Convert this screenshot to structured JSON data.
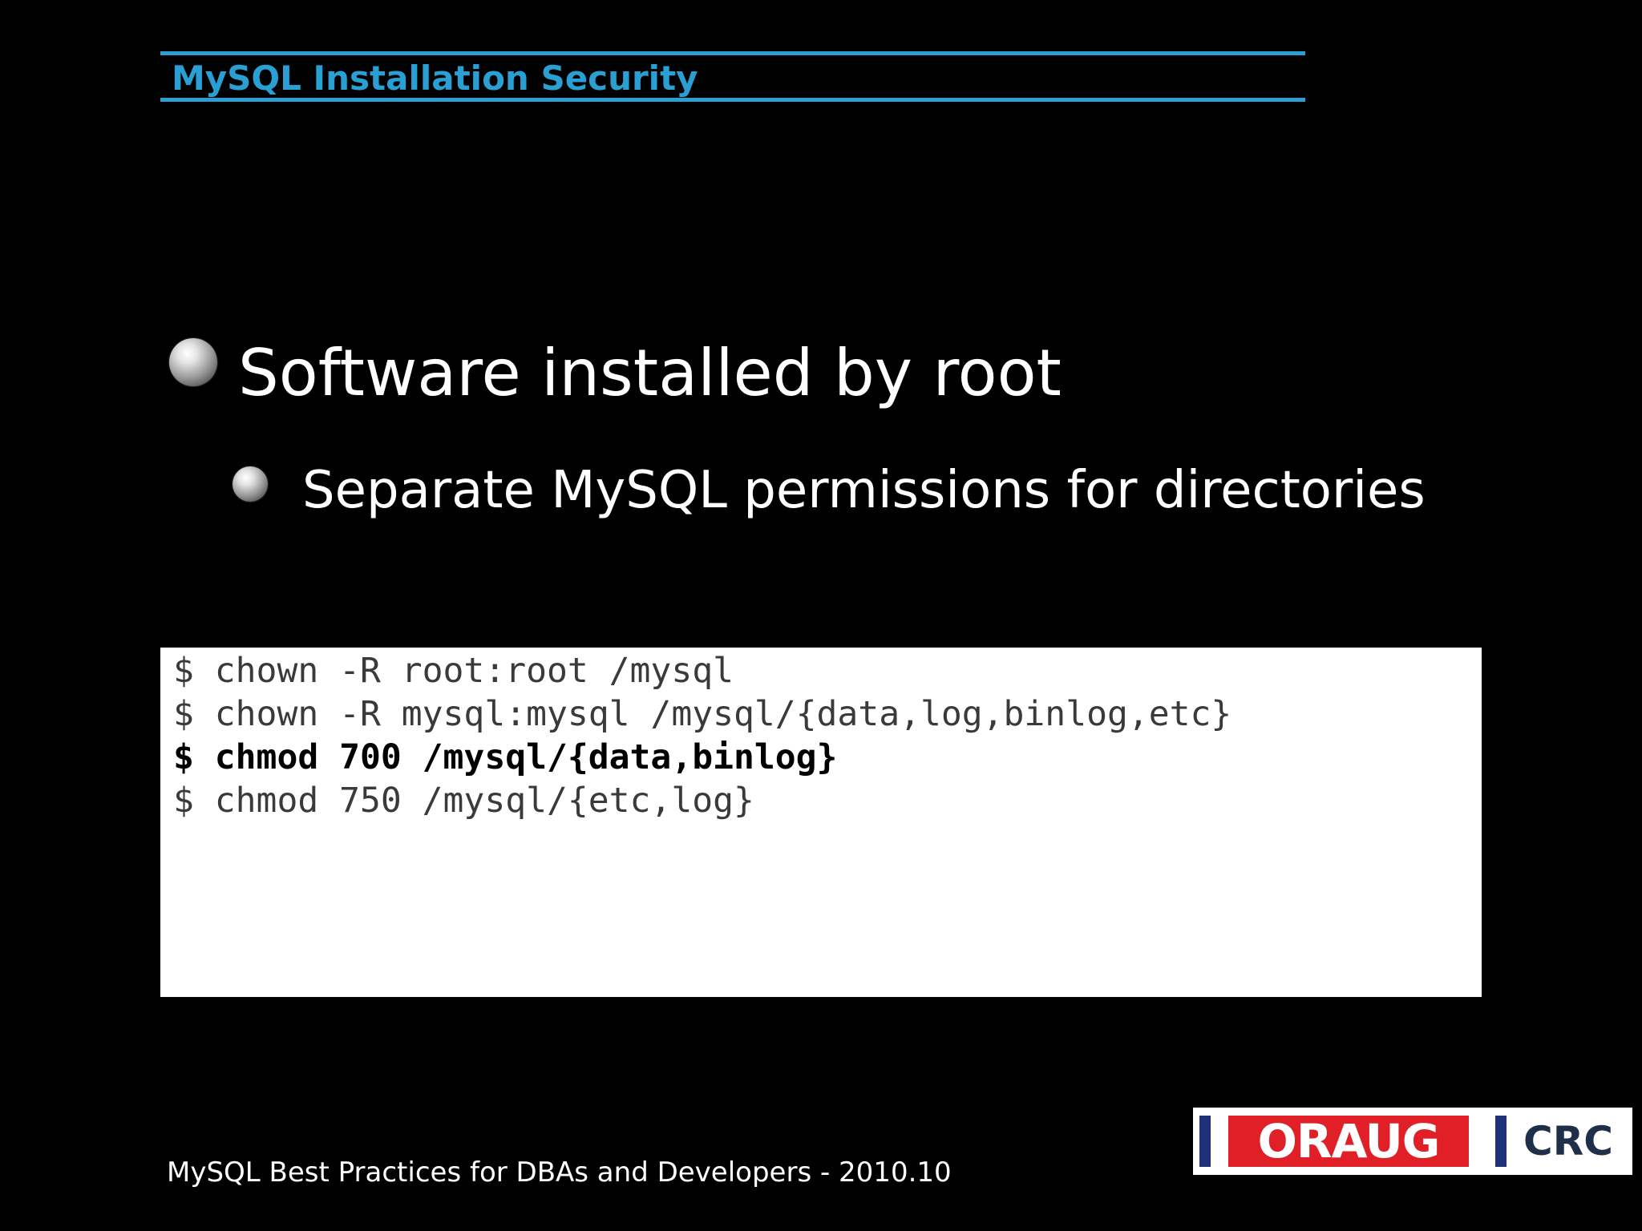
{
  "slide": {
    "title": "MySQL Installation Security",
    "bullets": [
      {
        "text": "Software installed by root"
      },
      {
        "text": "Separate MySQL permissions for directories"
      }
    ],
    "code": [
      {
        "text": "$ chown -R root:root /mysql",
        "bold": false
      },
      {
        "text": "$ chown -R mysql:mysql /mysql/{data,log,binlog,etc}",
        "bold": false
      },
      {
        "text": "$ chmod 700 /mysql/{data,binlog}",
        "bold": true
      },
      {
        "text": "$ chmod 750 /mysql/{etc,log}",
        "bold": false
      }
    ],
    "footer": "MySQL Best Practices for DBAs and Developers - 2010.10",
    "logo": {
      "left_text": "ORAUG",
      "right_text": "CRC",
      "colors": {
        "red": "#e02026",
        "navy": "#1f2f7a"
      }
    },
    "colors": {
      "background": "#000000",
      "accent": "#2a9fd3",
      "text": "#ffffff",
      "code_background": "#ffffff"
    }
  }
}
